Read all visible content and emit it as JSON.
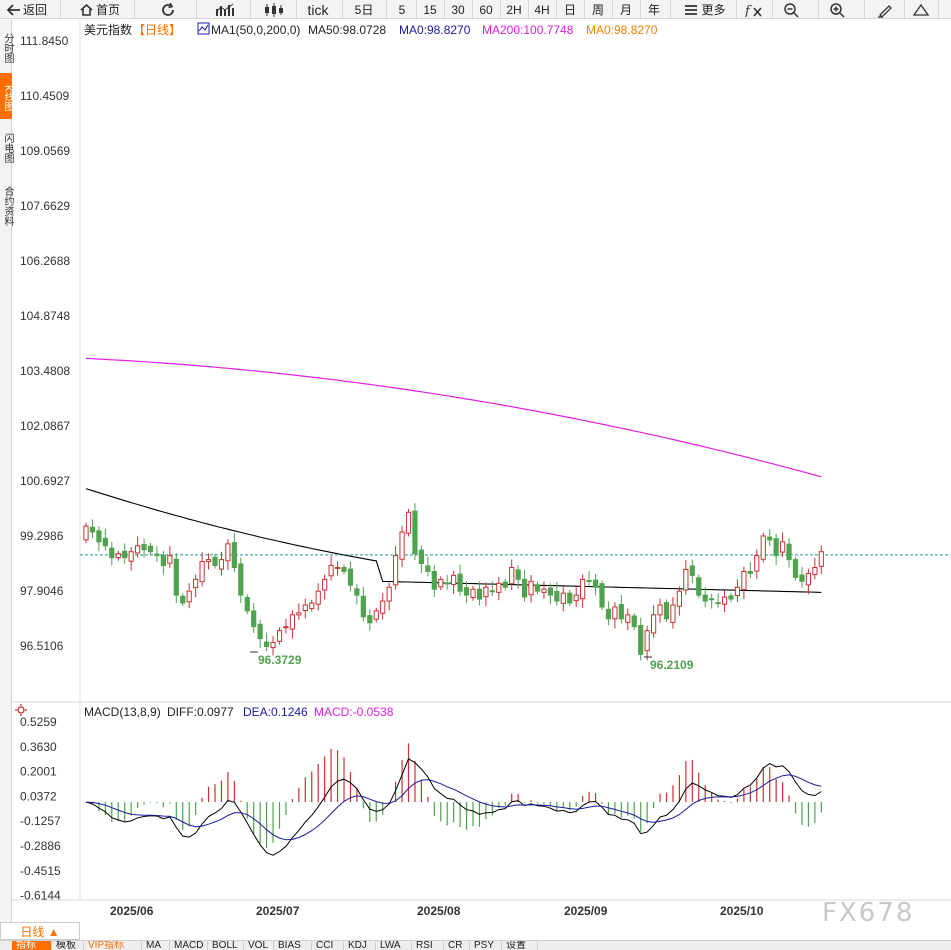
{
  "toolbar": {
    "back": "返回",
    "home": "首页",
    "tick": "tick",
    "periods": [
      "5日",
      "5",
      "15",
      "30",
      "60",
      "2H",
      "4H",
      "日",
      "周",
      "月",
      "年"
    ],
    "more": "更多"
  },
  "side_tabs": [
    "分时图",
    "K线图",
    "闪电图",
    "合约资料"
  ],
  "legend": {
    "symbol": "美元指数",
    "period": "【日线】",
    "ma_set": "MA1(50,0,200,0)",
    "ma50": "MA50:98.0728",
    "ma0a": "MA0:98.8270",
    "ma200": "MA200:100.7748",
    "ma0b": "MA0:98.8270"
  },
  "macd_legend": {
    "name": "MACD(13,8,9)",
    "diff": "DIFF:0.0977",
    "dea": "DEA:0.1246",
    "macd": "MACD:-0.0538"
  },
  "price_axis": [
    "111.8450",
    "110.4509",
    "109.0569",
    "107.6629",
    "106.2688",
    "104.8748",
    "103.4808",
    "102.0867",
    "100.6927",
    "99.2986",
    "97.9046",
    "96.5106"
  ],
  "macd_axis": [
    "0.5259",
    "0.3630",
    "0.2001",
    "0.0372",
    "-0.1257",
    "-0.2886",
    "-0.4515",
    "-0.6144"
  ],
  "date_labels": [
    "2025/06",
    "2025/07",
    "2025/08",
    "2025/09",
    "2025/10"
  ],
  "annotations": {
    "low1": "96.3729",
    "low2": "96.2109"
  },
  "bottom": {
    "period_button": "日线 ▲",
    "tabs": [
      "指标",
      "模板",
      "VIP指标",
      "MA",
      "MACD",
      "BOLL",
      "VOL",
      "BIAS",
      "CCI",
      "KDJ",
      "LWA",
      "RSI",
      "CR",
      "PSY",
      "设置"
    ]
  },
  "watermark": "FX678",
  "colors": {
    "up": "#c83232",
    "down": "#4fa34f",
    "ma50": "#000000",
    "ma200": "#e020e0",
    "ma0": "#1a1aa0",
    "ma0b": "#f08000",
    "dea": "#1a1aa0",
    "macd": "#e020e0",
    "current_line": "#1a9a8a",
    "annotation": "#4fa34f"
  },
  "chart_data": {
    "type": "candlestick",
    "y_range": [
      95.6,
      112.2
    ],
    "current_price": 98.82,
    "closes": [
      99.55,
      99.4,
      99.15,
      99.05,
      98.75,
      98.85,
      98.75,
      98.9,
      99.05,
      98.95,
      98.9,
      98.8,
      98.55,
      98.8,
      97.8,
      97.6,
      97.9,
      98.2,
      98.65,
      98.7,
      98.55,
      98.7,
      99.1,
      98.5,
      97.8,
      97.4,
      97.0,
      96.7,
      96.5,
      96.6,
      96.9,
      97.0,
      97.3,
      97.35,
      97.55,
      97.6,
      97.9,
      98.2,
      98.55,
      98.5,
      98.4,
      98.05,
      97.8,
      97.25,
      97.1,
      97.4,
      97.65,
      98.0,
      98.8,
      99.4,
      99.9,
      98.85,
      98.6,
      98.4,
      97.95,
      98.2,
      98.1,
      98.3,
      97.9,
      97.8,
      97.95,
      97.7,
      98.0,
      97.9,
      98.1,
      98.0,
      98.5,
      98.2,
      97.75,
      98.15,
      97.9,
      97.95,
      97.8,
      97.65,
      97.85,
      97.6,
      97.8,
      98.2,
      98.15,
      98.0,
      97.5,
      97.2,
      97.5,
      97.2,
      97.3,
      97.0,
      96.3,
      96.9,
      97.3,
      97.55,
      97.2,
      97.55,
      97.9,
      98.45,
      98.3,
      97.8,
      97.65,
      97.7,
      97.6,
      97.75,
      97.7,
      98.0,
      98.4,
      98.35,
      98.8,
      99.3,
      99.2,
      98.8,
      99.15,
      98.7,
      98.25,
      98.15,
      98.35,
      98.5,
      98.9
    ]
  }
}
